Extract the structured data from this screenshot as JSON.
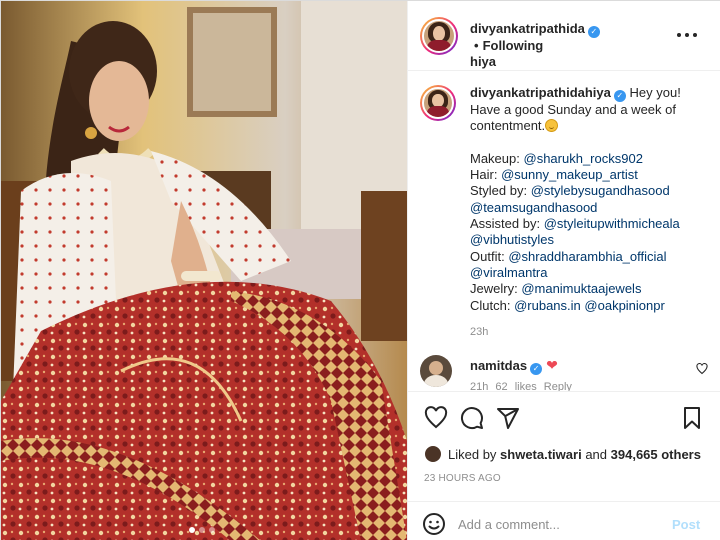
{
  "post": {
    "image_alt": "Woman in red embroidered bridal lehenga with white dupatta",
    "carousel": {
      "count": 3,
      "active": 0
    }
  },
  "header": {
    "username": "divyankatripathidahiya",
    "username_line1": "divyankatripathida",
    "username_line2": "hiya",
    "separator": "•",
    "follow_status": "Following",
    "more": "•••"
  },
  "caption": {
    "username": "divyankatripathidahiya",
    "greeting_1": "Hey you!",
    "greeting_2": "Have a good Sunday and a week of",
    "greeting_3": "contentment.",
    "credits": [
      {
        "label": "Makeup:",
        "handles": [
          "@sharukh_rocks902"
        ]
      },
      {
        "label": "Hair:",
        "handles": [
          "@sunny_makeup_artist"
        ]
      },
      {
        "label": "Styled by:",
        "handles": [
          "@stylebysugandhasood"
        ]
      },
      {
        "label": "",
        "handles": [
          "@teamsugandhasood"
        ]
      },
      {
        "label": "Assisted by:",
        "handles": [
          "@styleitupwithmicheala"
        ]
      },
      {
        "label": "",
        "handles": [
          "@vibhutistyles"
        ]
      },
      {
        "label": "Outfit:",
        "handles": [
          "@shraddharambhia_official"
        ]
      },
      {
        "label": "",
        "handles": [
          "@viralmantra"
        ]
      },
      {
        "label": "Jewelry:",
        "handles": [
          "@manimuktaajewels"
        ]
      },
      {
        "label": "Clutch:",
        "handles": [
          "@rubans.in",
          "@oakpinionpr"
        ]
      }
    ],
    "time": "23h"
  },
  "comment": {
    "username": "namitdas",
    "time": "21h",
    "likes": "62 likes",
    "reply": "Reply"
  },
  "likes": {
    "prefix": "Liked by",
    "user": "shweta.tiwari",
    "and": "and",
    "count": "394,665 others"
  },
  "time_ago": "23 HOURS AGO",
  "add_comment": {
    "placeholder": "Add a comment...",
    "post_label": "Post"
  },
  "colors": {
    "verified": "#3897f0",
    "link": "#00376b",
    "heart": "#ed4956",
    "post_disabled": "#b2dffc",
    "muted": "#8e8e8e"
  }
}
